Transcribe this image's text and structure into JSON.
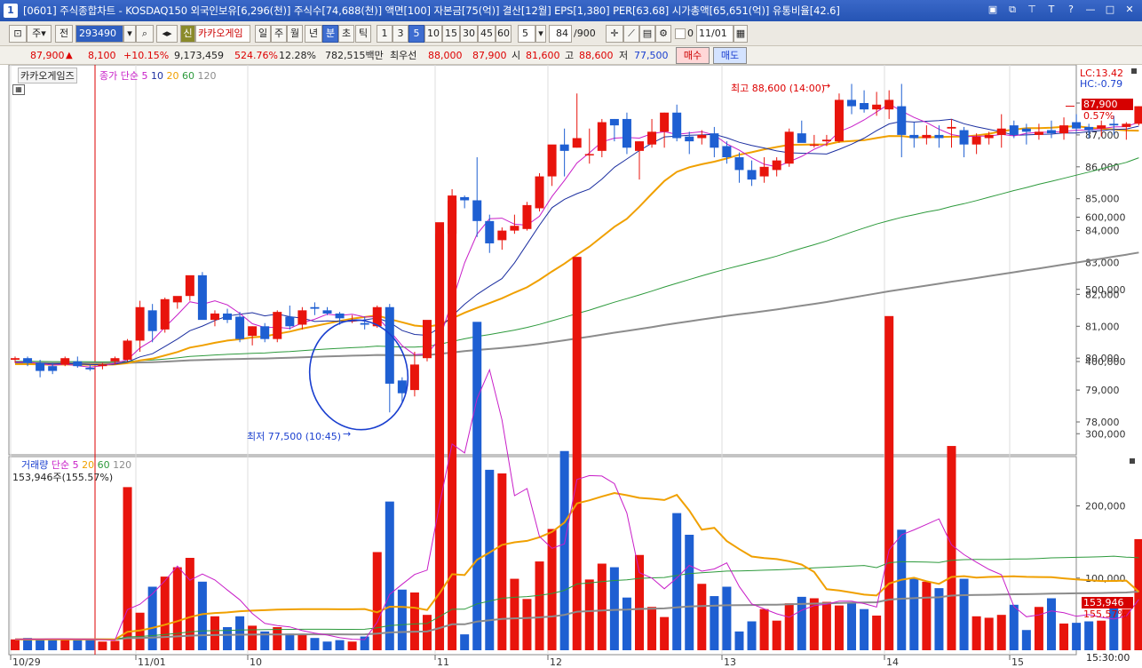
{
  "window": {
    "number": "1",
    "title": "[0601] 주식종합차트 - KOSDAQ150 외국인보유[6,296(천)] 주식수[74,688(천)] 액면[100] 자본금[75(억)] 결산[12월] EPS[1,380] PER[63.68] 시가총액[65,651(억)] 유통비율[42.6]"
  },
  "toolbar": {
    "mode_label": "주",
    "market_label": "전",
    "stock_code": "293490",
    "stock_name": "카카오게임",
    "new_badge": "신",
    "periods": [
      "일",
      "주",
      "월",
      "년",
      "분",
      "초",
      "틱"
    ],
    "active_period": "분",
    "minute_intervals": [
      "1",
      "3",
      "5",
      "10",
      "15",
      "30",
      "45",
      "60"
    ],
    "active_interval": "5",
    "interval_value": "5",
    "count_current": "84",
    "count_total": "/900",
    "zero_checkbox_label": "0",
    "date_value": "11/01"
  },
  "quote": {
    "price": "87,900",
    "change": "8,100",
    "change_rate": "+10.15%",
    "volume": "9,173,459",
    "volume_ratio": "524.76%",
    "turnover": "12.28%",
    "amount": "782,515백만",
    "best_bid_label": "최우선",
    "best_bid": "88,000",
    "best_ask": "87,900",
    "open_label": "시",
    "open": "81,600",
    "high_label": "고",
    "high": "88,600",
    "low_label": "저",
    "low": "77,500",
    "buy_label": "매수",
    "sell_label": "매도"
  },
  "price_panel": {
    "stock_tag": "카카오게임즈",
    "ma_title": "종가 단순",
    "ma_periods": [
      "5",
      "10",
      "20",
      "60",
      "120"
    ],
    "lc_label": "LC:13.42",
    "hc_label": "HC:-0.79",
    "current_price_tag": "87,900",
    "current_rate_tag": "0.57%",
    "high_annotation": "최고 88,600 (14:00)",
    "low_annotation": "최저 77,500 (10:45)",
    "y_ticks": [
      "88,000",
      "87,000",
      "86,000",
      "85,000",
      "84,000",
      "83,000",
      "82,000",
      "81,000",
      "80,000",
      "79,000",
      "78,000"
    ]
  },
  "volume_panel": {
    "title": "거래량",
    "ma_title": "단순",
    "ma_periods": [
      "5",
      "20",
      "60",
      "120"
    ],
    "current_label": "153,946주(155.57%)",
    "current_tag": "153,946",
    "current_rate_tag": "155.57%",
    "y_ticks": [
      "600,000",
      "500,000",
      "400,000",
      "300,000",
      "200,000",
      "100,000"
    ]
  },
  "x_axis": {
    "labels": [
      "10/29",
      "11/01",
      "10",
      "11",
      "12",
      "13",
      "14",
      "15"
    ],
    "time_label": "15:30:00"
  },
  "colors": {
    "up": "#e8140c",
    "down": "#1e5fd2",
    "ma5": "#c81ec8",
    "ma10": "#1c2fa0",
    "ma20": "#f0a000",
    "ma60": "#2d9a3c",
    "ma120": "#8c8c8c"
  },
  "chart_data": {
    "type": "candlestick",
    "interval": "5분",
    "candles": [
      [
        79950,
        80050,
        79850,
        80000
      ],
      [
        80000,
        80050,
        79750,
        79850
      ],
      [
        79850,
        79950,
        79400,
        79600
      ],
      [
        79750,
        79850,
        79500,
        79600
      ],
      [
        79800,
        80050,
        79750,
        80000
      ],
      [
        79900,
        80050,
        79700,
        79750
      ],
      [
        79700,
        79800,
        79600,
        79650
      ],
      [
        79750,
        79850,
        79650,
        79800
      ],
      [
        79900,
        80050,
        79800,
        80000
      ],
      [
        79950,
        80600,
        79900,
        80550
      ],
      [
        80550,
        81800,
        80200,
        81600
      ],
      [
        81500,
        81700,
        80500,
        80850
      ],
      [
        80900,
        81900,
        80800,
        81850
      ],
      [
        81750,
        81900,
        81550,
        81950
      ],
      [
        81950,
        82500,
        81800,
        82600
      ],
      [
        82600,
        82700,
        81500,
        81200
      ],
      [
        81200,
        81500,
        81000,
        81400
      ],
      [
        81400,
        81550,
        81100,
        81200
      ],
      [
        81300,
        81450,
        80500,
        80600
      ],
      [
        80700,
        81000,
        80400,
        81000
      ],
      [
        81000,
        81100,
        80500,
        80600
      ],
      [
        80600,
        81500,
        80500,
        81450
      ],
      [
        81300,
        81650,
        80900,
        81000
      ],
      [
        81050,
        81600,
        80900,
        81500
      ],
      [
        81600,
        81750,
        81350,
        81550
      ],
      [
        81500,
        81600,
        81350,
        81400
      ],
      [
        81400,
        81450,
        81050,
        81250
      ],
      [
        81200,
        81350,
        81100,
        81200
      ],
      [
        81100,
        81300,
        80900,
        81050
      ],
      [
        81000,
        81650,
        80950,
        81600
      ],
      [
        81600,
        81700,
        78300,
        79200
      ],
      [
        79300,
        79400,
        78600,
        78900
      ],
      [
        79000,
        80200,
        78800,
        79800
      ],
      [
        80000,
        81100,
        79900,
        81200
      ],
      [
        81100,
        83800,
        81050,
        83900
      ],
      [
        83900,
        85300,
        83700,
        85100
      ],
      [
        85050,
        85100,
        84700,
        84950
      ],
      [
        84950,
        86300,
        83800,
        84300
      ],
      [
        84300,
        84500,
        83300,
        83600
      ],
      [
        83700,
        84100,
        83400,
        84000
      ],
      [
        84000,
        84500,
        83900,
        84150
      ],
      [
        84050,
        84900,
        84000,
        84800
      ],
      [
        84700,
        85800,
        84600,
        85700
      ],
      [
        85700,
        86400,
        85400,
        86700
      ],
      [
        86700,
        87200,
        85700,
        86500
      ],
      [
        86600,
        88300,
        86600,
        86900
      ],
      [
        86400,
        87200,
        86100,
        86400
      ],
      [
        86500,
        87500,
        86300,
        87400
      ],
      [
        87500,
        87500,
        86800,
        87300
      ],
      [
        87500,
        87700,
        86400,
        86600
      ],
      [
        86500,
        86800,
        85600,
        86800
      ],
      [
        86700,
        87500,
        86600,
        87100
      ],
      [
        87100,
        87700,
        86600,
        87700
      ],
      [
        87700,
        87950,
        86800,
        86900
      ],
      [
        86950,
        87100,
        86400,
        86800
      ],
      [
        86900,
        87150,
        86700,
        87000
      ],
      [
        87050,
        87250,
        86300,
        86600
      ],
      [
        86650,
        86800,
        86100,
        86300
      ],
      [
        86300,
        86450,
        85500,
        85900
      ],
      [
        85900,
        86200,
        85400,
        85600
      ],
      [
        85700,
        86300,
        85500,
        86000
      ],
      [
        85900,
        86300,
        85700,
        86200
      ],
      [
        86100,
        87200,
        86000,
        87100
      ],
      [
        87050,
        87450,
        86900,
        86750
      ],
      [
        86700,
        87000,
        86600,
        86700
      ],
      [
        86800,
        87000,
        86650,
        86850
      ],
      [
        86800,
        88300,
        86750,
        88100
      ],
      [
        88100,
        88600,
        87650,
        87900
      ],
      [
        88000,
        88400,
        87700,
        87800
      ],
      [
        87800,
        88350,
        87600,
        87950
      ],
      [
        87800,
        88400,
        87500,
        88100
      ],
      [
        87900,
        88600,
        86300,
        87000
      ],
      [
        87000,
        87400,
        86600,
        86900
      ],
      [
        86900,
        87300,
        86700,
        87000
      ],
      [
        87000,
        87300,
        86600,
        86900
      ],
      [
        87200,
        87500,
        86600,
        87250
      ],
      [
        87150,
        87250,
        86300,
        86700
      ],
      [
        86700,
        87050,
        86400,
        86950
      ],
      [
        86900,
        87100,
        86700,
        87000
      ],
      [
        87000,
        87650,
        86600,
        87200
      ],
      [
        87300,
        87450,
        86900,
        87000
      ],
      [
        87200,
        87350,
        86700,
        87100
      ],
      [
        87000,
        87350,
        86850,
        87100
      ],
      [
        87150,
        87450,
        86900,
        87050
      ],
      [
        87050,
        87550,
        86850,
        87300
      ],
      [
        87400,
        87650,
        87100,
        87200
      ],
      [
        87250,
        87350,
        86900,
        87150
      ],
      [
        87200,
        87450,
        86950,
        87300
      ],
      [
        87350,
        87600,
        87000,
        87300
      ],
      [
        87250,
        87400,
        86850,
        87350
      ],
      [
        87350,
        87900,
        87300,
        87900
      ]
    ],
    "volumes": [
      15000,
      17000,
      15000,
      16000,
      15000,
      14000,
      16000,
      12000,
      13000,
      226000,
      52000,
      88000,
      102000,
      115000,
      128000,
      95000,
      47000,
      32000,
      47000,
      34000,
      26000,
      32000,
      23000,
      21000,
      17000,
      12000,
      14000,
      12000,
      19000,
      136000,
      206000,
      84000,
      80000,
      49000,
      593000,
      623000,
      22000,
      455000,
      250000,
      245000,
      99000,
      71000,
      123000,
      168000,
      276000,
      545000,
      98000,
      120000,
      115000,
      73000,
      132000,
      60000,
      46000,
      190000,
      160000,
      92000,
      75000,
      88000,
      26000,
      40000,
      57000,
      41000,
      65000,
      74000,
      72000,
      67000,
      62000,
      65000,
      57000,
      48000,
      463000,
      167000,
      99000,
      95000,
      86000,
      283000,
      99000,
      47000,
      45000,
      49000,
      63000,
      28000,
      60000,
      72000,
      37000,
      38000,
      40000,
      41000,
      60000,
      57000,
      153946
    ],
    "ylim": [
      77500,
      89000
    ],
    "volume_ylim": [
      0,
      640000
    ]
  }
}
